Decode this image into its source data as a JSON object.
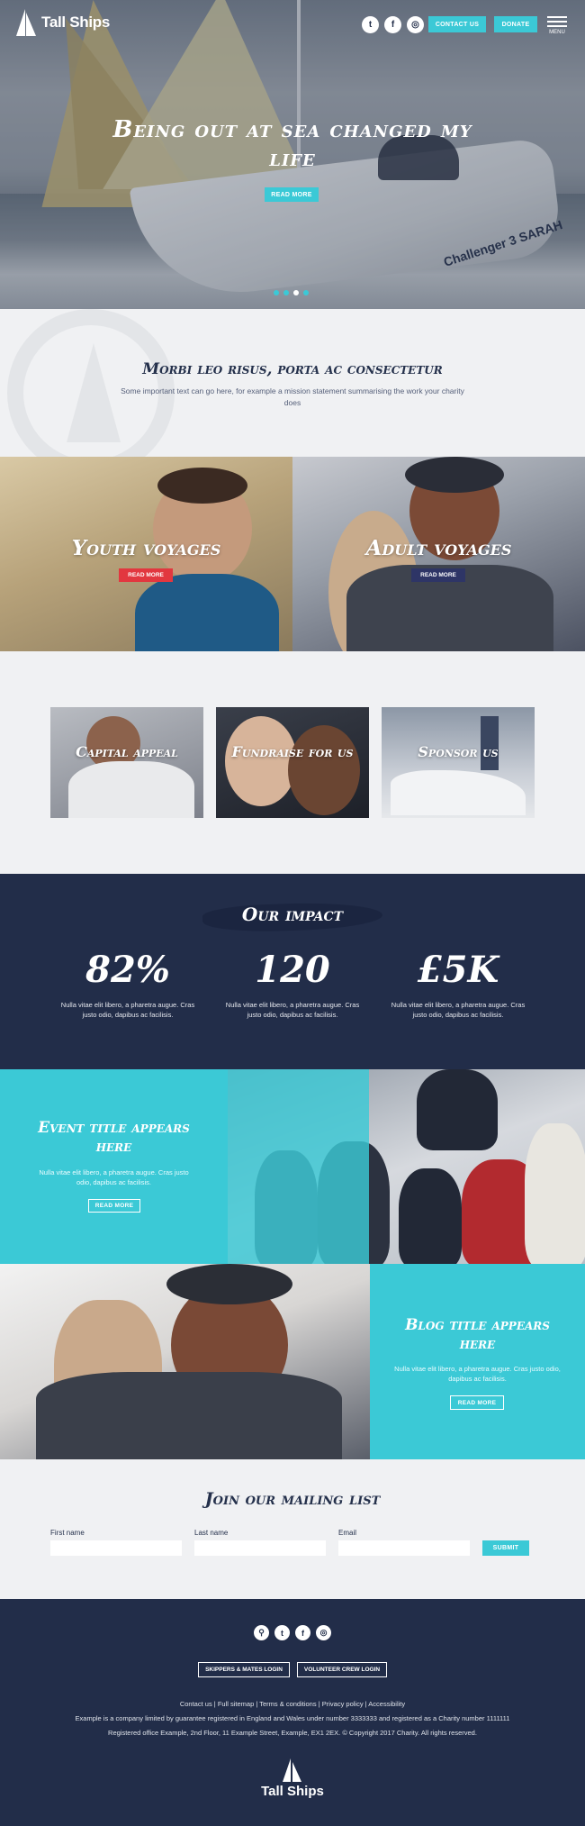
{
  "brand": {
    "name": "Tall Ships"
  },
  "header": {
    "social_icons": [
      "twitter-icon",
      "facebook-icon",
      "instagram-icon"
    ],
    "social_glyphs": [
      "t",
      "f",
      "◎"
    ],
    "contact_label": "CONTACT US",
    "donate_label": "DONATE",
    "menu_label": "MENU"
  },
  "hero": {
    "title": "Being out at sea changed my life",
    "button_label": "READ MORE",
    "hull_text": "Challenger 3 SARAH",
    "slides": 4,
    "active_slide": 3
  },
  "mission": {
    "title": "Morbi leo risus, porta ac consectetur",
    "text": "Some important text can go here, for example a mission statement summarising the work your charity does"
  },
  "voyages": [
    {
      "title": "Youth voyages",
      "button_label": "READ MORE",
      "button_color": "#e2373f"
    },
    {
      "title": "Adult voyages",
      "button_label": "READ MORE",
      "button_color": "#2e3566"
    }
  ],
  "cards": [
    {
      "title": "Capital appeal"
    },
    {
      "title": "Fundraise for us"
    },
    {
      "title": "Sponsor us"
    }
  ],
  "impact": {
    "title": "Our impact",
    "stats": [
      {
        "value": "82%",
        "desc": "Nulla vitae elit libero, a pharetra augue. Cras justo odio, dapibus ac facilisis."
      },
      {
        "value": "120",
        "desc": "Nulla vitae elit libero, a pharetra augue. Cras justo odio, dapibus ac facilisis."
      },
      {
        "value": "£5K",
        "desc": "Nulla vitae elit libero, a pharetra augue. Cras justo odio, dapibus ac facilisis."
      }
    ]
  },
  "event": {
    "title": "Event title appears here",
    "desc": "Nulla vitae elit libero, a pharetra augue. Cras justo odio, dapibus ac facilisis.",
    "button_label": "READ MORE"
  },
  "blog": {
    "title": "Blog title appears here",
    "desc": "Nulla vitae elit libero, a pharetra augue. Cras justo odio, dapibus ac facilisis.",
    "button_label": "READ MORE"
  },
  "mailing": {
    "title": "Join our mailing list",
    "first_name_label": "First name",
    "last_name_label": "Last name",
    "email_label": "Email",
    "submit_label": "SUBMIT"
  },
  "footer": {
    "social_icons": [
      "search-icon",
      "twitter-icon",
      "facebook-icon",
      "instagram-icon"
    ],
    "social_glyphs": [
      "⚲",
      "t",
      "f",
      "◎"
    ],
    "skippers_login": "SKIPPERS & MATES LOGIN",
    "crew_login": "VOLUNTEER CREW LOGIN",
    "links": [
      "Contact us",
      "Full sitemap",
      "Terms & conditions",
      "Privacy policy",
      "Accessibility"
    ],
    "company_line": "Example is a company limited by guarantee registered in England and Wales under number 3333333 and registered as a Charity number 1111111",
    "address_line": "Registered office Example, 2nd Floor, 11 Example Street, Example, EX1 2EX. © Copyright 2017 Charity. All rights reserved.",
    "logo_text": "Tall Ships"
  },
  "colors": {
    "teal": "#3bc9d6",
    "navy": "#222d49",
    "red": "#e2373f",
    "indigo": "#2e3566",
    "light": "#f0f1f3"
  }
}
